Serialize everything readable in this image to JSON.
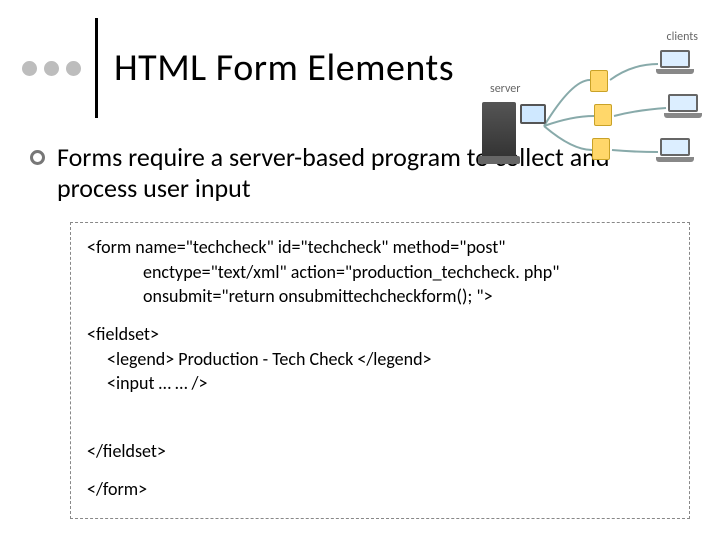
{
  "title": "HTML Form Elements",
  "bullet": "Forms require a server-based program to collect and process user input",
  "diagram": {
    "server_label": "server",
    "clients_label": "clients"
  },
  "code": {
    "form_open": "<form name=\"techcheck\" id=\"techcheck\" method=\"post\"",
    "form_l2": "enctype=\"text/xml\" action=\"production_techcheck. php\"",
    "form_l3": "onsubmit=\"return onsubmittechcheckform(); \">",
    "fieldset_open": "<fieldset>",
    "legend": "<legend> Production - Tech Check </legend>",
    "input": "<input …   … />",
    "fieldset_close": "</fieldset>",
    "form_close": "</form>"
  }
}
